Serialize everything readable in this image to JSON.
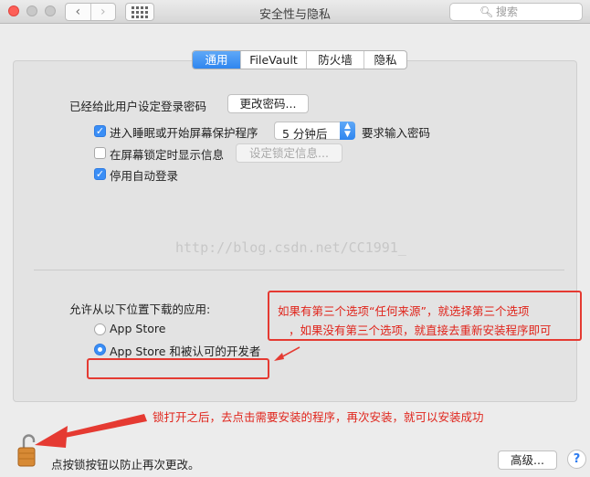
{
  "window": {
    "title": "安全性与隐私",
    "nav_back": "‹",
    "nav_forward": "›",
    "search_placeholder": "搜索"
  },
  "tabs": [
    {
      "label": "通用",
      "active": true
    },
    {
      "label": "FileVault",
      "active": false
    },
    {
      "label": "防火墙",
      "active": false
    },
    {
      "label": "隐私",
      "active": false
    }
  ],
  "general": {
    "password_label": "已经给此用户设定登录密码",
    "change_password_button": "更改密码...",
    "require_password": {
      "label": "进入睡眠或开始屏幕保护程序",
      "checked": true
    },
    "require_password_delay": "5 分钟后",
    "require_password_suffix": "要求输入密码",
    "show_message": {
      "label": "在屏幕锁定时显示信息",
      "checked": false
    },
    "set_lock_message_button": "设定锁定信息...",
    "disable_autologin": {
      "label": "停用自动登录",
      "checked": true
    }
  },
  "watermark": "http://blog.csdn.net/CC1991_",
  "apps": {
    "heading": "允许从以下位置下载的应用:",
    "options": [
      {
        "label": "App Store",
        "selected": false
      },
      {
        "label": "App Store 和被认可的开发者",
        "selected": true
      }
    ]
  },
  "annotations": {
    "callout_line1": "如果有第三个选项“任何来源”，就选择第三个选项",
    "callout_line2": "，如果没有第三个选项，就直接去重新安装程序即可",
    "lock_note": "锁打开之后，去点击需要安装的程序，再次安装，就可以安装成功",
    "color": "#e53a32"
  },
  "footer": {
    "lock_text": "点按锁按钮以防止再次更改。",
    "advanced_button": "高级...",
    "help": "?"
  }
}
